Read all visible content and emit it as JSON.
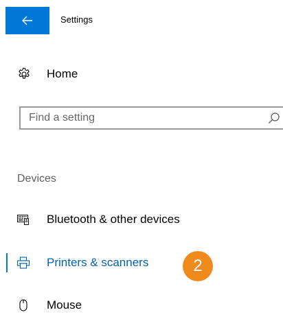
{
  "titlebar": {
    "back_icon": "back-arrow-icon",
    "title": "Settings"
  },
  "home": {
    "icon": "gear-icon",
    "label": "Home"
  },
  "search": {
    "value": "",
    "placeholder": "Find a setting",
    "icon": "search-icon"
  },
  "section": {
    "header": "Devices"
  },
  "nav": {
    "items": [
      {
        "icon": "keyboard-icon",
        "label": "Bluetooth & other devices",
        "selected": false
      },
      {
        "icon": "printer-icon",
        "label": "Printers & scanners",
        "selected": true
      },
      {
        "icon": "mouse-icon",
        "label": "Mouse",
        "selected": false
      }
    ]
  },
  "annotation": {
    "step_number": "2"
  },
  "colors": {
    "accent": "#0078d7",
    "selected_text": "#0063b1",
    "badge": "#ef8a1c",
    "section_header": "#5f5f5f"
  }
}
